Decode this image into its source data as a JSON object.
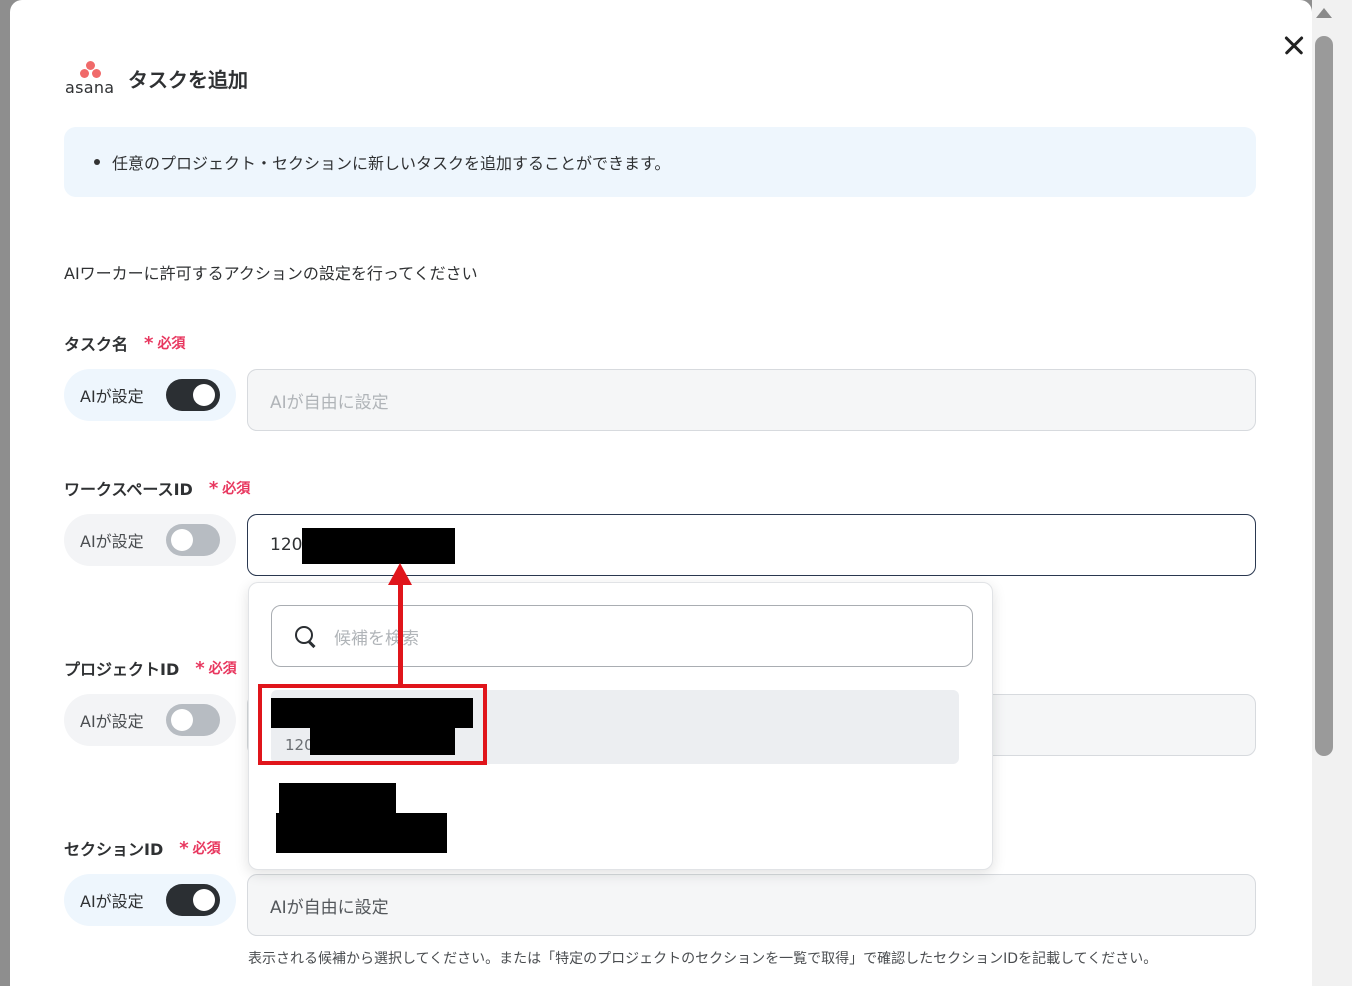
{
  "header": {
    "logo_text": "asana",
    "title": "タスクを追加"
  },
  "info": {
    "text": "任意のプロジェクト・セクションに新しいタスクを追加することができます。"
  },
  "intro": "AIワーカーに許可するアクションの設定を行ってください",
  "required_label": "必須",
  "ai_label": "AIが設定",
  "fields": {
    "task_name": {
      "label": "タスク名",
      "ai_enabled": true,
      "placeholder": "AIが自由に設定"
    },
    "workspace_id": {
      "label": "ワークスペースID",
      "ai_enabled": false,
      "value": "120"
    },
    "project_id": {
      "label": "プロジェクトID",
      "ai_enabled": false
    },
    "section_id": {
      "label": "セクションID",
      "ai_enabled": true,
      "value": "AIが自由に設定",
      "hint": "表示される候補から選択してください。または「特定のプロジェクトのセクションを一覧で取得」で確認したセクションIDを記載してください。"
    }
  },
  "dropdown": {
    "search_placeholder": "候補を検索",
    "options": [
      {
        "sub": "120"
      }
    ]
  },
  "colors": {
    "accent_red": "#e0151b",
    "required": "#e8375f",
    "toggle_on": "#2b2f33"
  }
}
